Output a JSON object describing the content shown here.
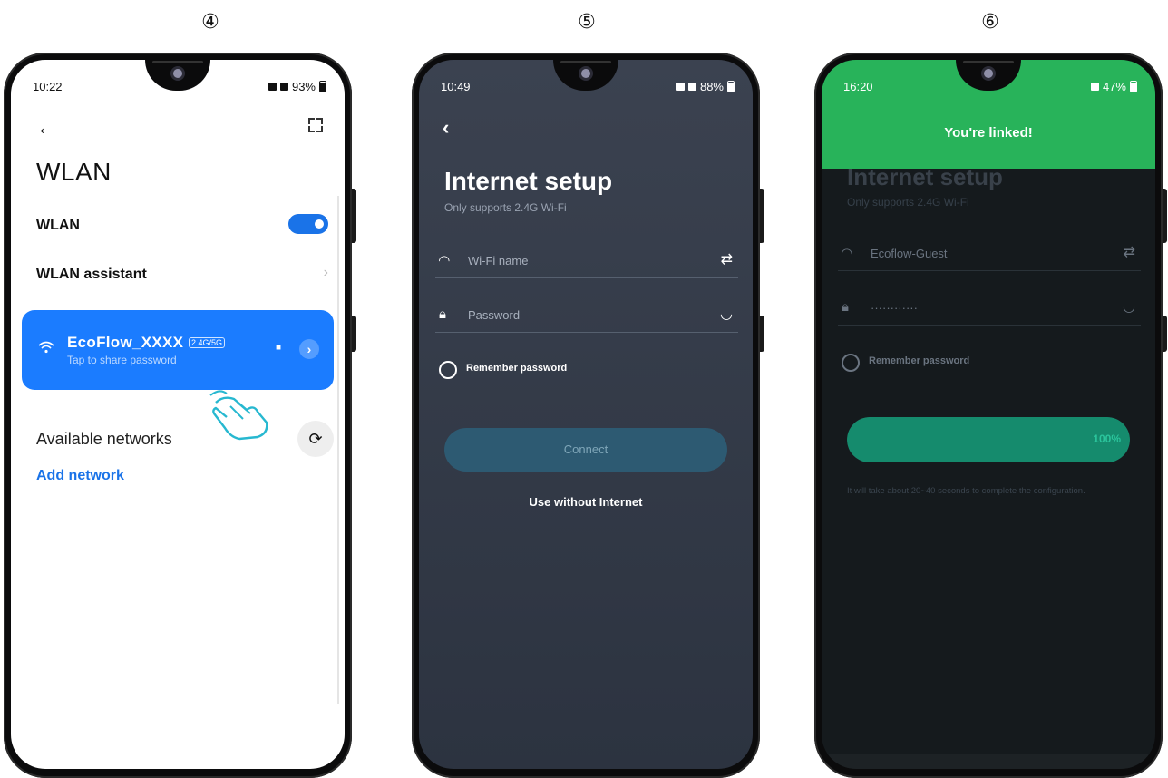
{
  "steps": [
    "④",
    "⑤",
    "⑥"
  ],
  "phone1": {
    "time": "10:22",
    "status_right": "93%",
    "title": "WLAN",
    "wlan_label": "WLAN",
    "wlan_on": true,
    "assistant_label": "WLAN assistant",
    "network": {
      "name": "EcoFlow_XXXX",
      "band": "2.4G/5G",
      "subtitle": "Tap to share password"
    },
    "available_label": "Available networks",
    "add_network": "Add network",
    "icons": [
      "back-arrow-icon",
      "scan-icon",
      "wifi-icon",
      "lock-icon",
      "chevron-right-icon",
      "hand-pointer-icon",
      "refresh-icon"
    ],
    "colors": {
      "accent": "#1b7cff"
    }
  },
  "phone2": {
    "time": "10:49",
    "status_right": "88%",
    "title": "Internet setup",
    "subtitle": "Only supports 2.4G Wi-Fi",
    "wifi_placeholder": "Wi-Fi name",
    "password_placeholder": "Password",
    "remember": "Remember password",
    "connect": "Connect",
    "use_without": "Use without Internet",
    "colors": {
      "button": "#2d5a72"
    }
  },
  "phone3": {
    "time": "16:20",
    "status_right": "47%",
    "banner": "You're linked!",
    "title": "Internet setup",
    "subtitle": "Only supports 2.4G Wi-Fi",
    "wifi_value": "Ecoflow-Guest",
    "password_value": "············",
    "remember": "Remember password",
    "progress_percent": 100,
    "progress_label": "100%",
    "note": "It will take about 20~40 seconds to complete the configuration.",
    "colors": {
      "banner": "#28b35a",
      "progress": "#158b6d"
    }
  }
}
